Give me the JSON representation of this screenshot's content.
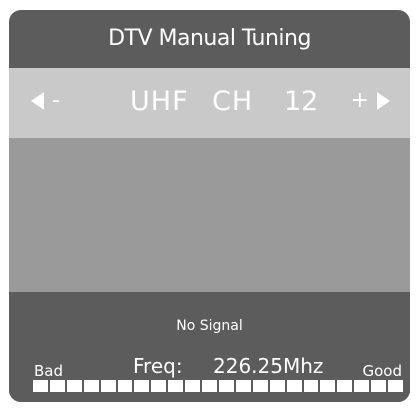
{
  "header": {
    "title": "DTV Manual Tuning"
  },
  "channel": {
    "left_sign": "-",
    "right_sign": "+",
    "band": "UHF",
    "ch_label": "CH",
    "number": "12"
  },
  "status": {
    "signal_text": "No Signal",
    "quality_low_label": "Bad",
    "quality_high_label": "Good",
    "freq_label": "Freq:",
    "freq_value": "226.25Mhz",
    "meter_segments": 22
  }
}
